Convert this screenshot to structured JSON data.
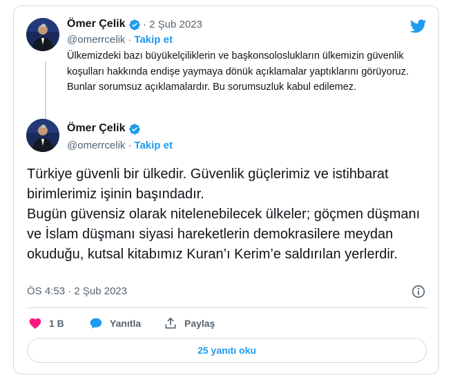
{
  "quoted_tweet": {
    "author_name": "Ömer Çelik",
    "handle": "@omerrcelik",
    "follow_label": "Takip et",
    "date": "2 Şub 2023",
    "text": "Ülkemizdeki bazı büyükelçiliklerin ve başkonsoloslukların ülkemizin güvenlik koşulları hakkında endişe yaymaya dönük açıklamalar yaptıklarını görüyoruz. Bunlar sorumsuz açıklamalardır. Bu sorumsuzluk kabul edilemez."
  },
  "main_tweet": {
    "author_name": "Ömer Çelik",
    "handle": "@omerrcelik",
    "follow_label": "Takip et",
    "text_p1": "Türkiye güvenli bir ülkedir. Güvenlik güçlerimiz ve istihbarat birimlerimiz işinin başındadır.",
    "text_p2": "Bugün güvensiz olarak nitelenebilecek ülkeler; göçmen düşmanı ve İslam düşmanı siyasi hareketlerin demokrasilere meydan okuduğu, kutsal kitabımız Kuran’ı Kerim’e saldırılan yerlerdir.",
    "timestamp": "ÖS 4:53 · 2 Şub 2023"
  },
  "actions": {
    "like_count": "1 B",
    "reply_label": "Yanıtla",
    "share_label": "Paylaş",
    "read_replies_label": "25 yanıtı oku"
  },
  "icons": {
    "brand": "twitter-bird-icon",
    "verified": "verified-badge-icon",
    "like": "heart-icon",
    "reply": "speech-bubble-icon",
    "share": "share-upload-icon",
    "info": "info-icon"
  },
  "colors": {
    "accent": "#1d9bf0",
    "like": "#f91880",
    "secondary_text": "#536471",
    "border": "#cfd9de"
  }
}
